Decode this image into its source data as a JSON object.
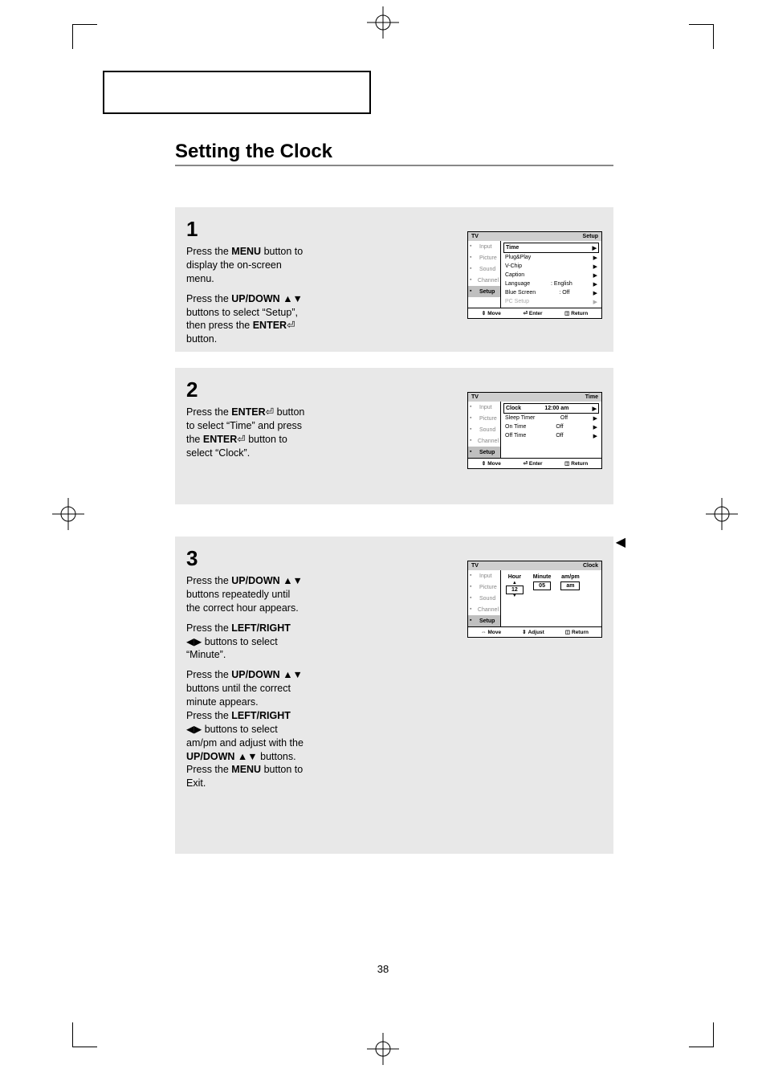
{
  "page_number": "38",
  "heading": "Setting the Clock",
  "side_arrow": "◀",
  "steps": [
    {
      "num": "1",
      "paras": [
        "Press the <b>MENU</b> button to display the on-screen menu.",
        "Press the <b>UP/DOWN</b> <span class='glyph'>▲▼</span> buttons to select “Setup”, then press the <b>ENTER</b><span class='glyph'>⏎</span> button."
      ]
    },
    {
      "num": "2",
      "paras": [
        "Press the <b>ENTER</b><span class='glyph'>⏎</span> button to select “Time” and press the <b>ENTER</b><span class='glyph'>⏎</span> button to select “Clock”."
      ]
    },
    {
      "num": "3",
      "paras": [
        "Press the <b>UP/DOWN</b> <span class='glyph'>▲▼</span> buttons repeatedly until the correct hour appears.",
        "Press the <b>LEFT/RIGHT</b> <span class='glyph'>◀▶</span> buttons to select “Minute”.",
        "Press the <b>UP/DOWN</b> <span class='glyph'>▲▼</span> buttons until the correct minute appears.<br>Press the <b>LEFT/RIGHT</b> <span class='glyph'>◀▶</span> buttons to select am/pm and adjust with the <b>UP/DOWN</b> <span class='glyph'>▲▼</span> buttons. Press the <b>MENU</b> button to Exit."
      ]
    }
  ],
  "osd": {
    "tv_label": "TV",
    "tabs": [
      "Input",
      "Picture",
      "Sound",
      "Channel",
      "Setup"
    ],
    "footer_move": "Move",
    "footer_enter": "Enter",
    "footer_adjust": "Adjust",
    "footer_return": "Return",
    "screen1": {
      "section": "Setup",
      "active_tab": 4,
      "rows": [
        {
          "label": "Time",
          "value": "",
          "arrow": "▶",
          "sel": true
        },
        {
          "label": "Plug&Play",
          "value": "",
          "arrow": "▶"
        },
        {
          "label": "V-Chip",
          "value": "",
          "arrow": "▶"
        },
        {
          "label": "Caption",
          "value": "",
          "arrow": "▶"
        },
        {
          "label": "Language",
          "value": ": English",
          "arrow": "▶"
        },
        {
          "label": "Blue Screen",
          "value": ": Off",
          "arrow": "▶"
        },
        {
          "label": "PC Setup",
          "value": "",
          "arrow": "▶",
          "dim": true
        }
      ]
    },
    "screen2": {
      "section": "Time",
      "active_tab": 4,
      "rows": [
        {
          "label": "Clock",
          "value": "12:00 am",
          "arrow": "▶",
          "sel": true
        },
        {
          "label": "Sleep Timer",
          "value": "Off",
          "arrow": "▶"
        },
        {
          "label": "On Time",
          "value": "Off",
          "arrow": "▶"
        },
        {
          "label": "Off Time",
          "value": "Off",
          "arrow": "▶"
        }
      ]
    },
    "screen3": {
      "section": "Clock",
      "active_tab": 4,
      "cols": [
        {
          "hdr": "Hour",
          "val": "12",
          "caret": true
        },
        {
          "hdr": "Minute",
          "val": "05"
        },
        {
          "hdr": "am/pm",
          "val": "am"
        }
      ]
    }
  }
}
